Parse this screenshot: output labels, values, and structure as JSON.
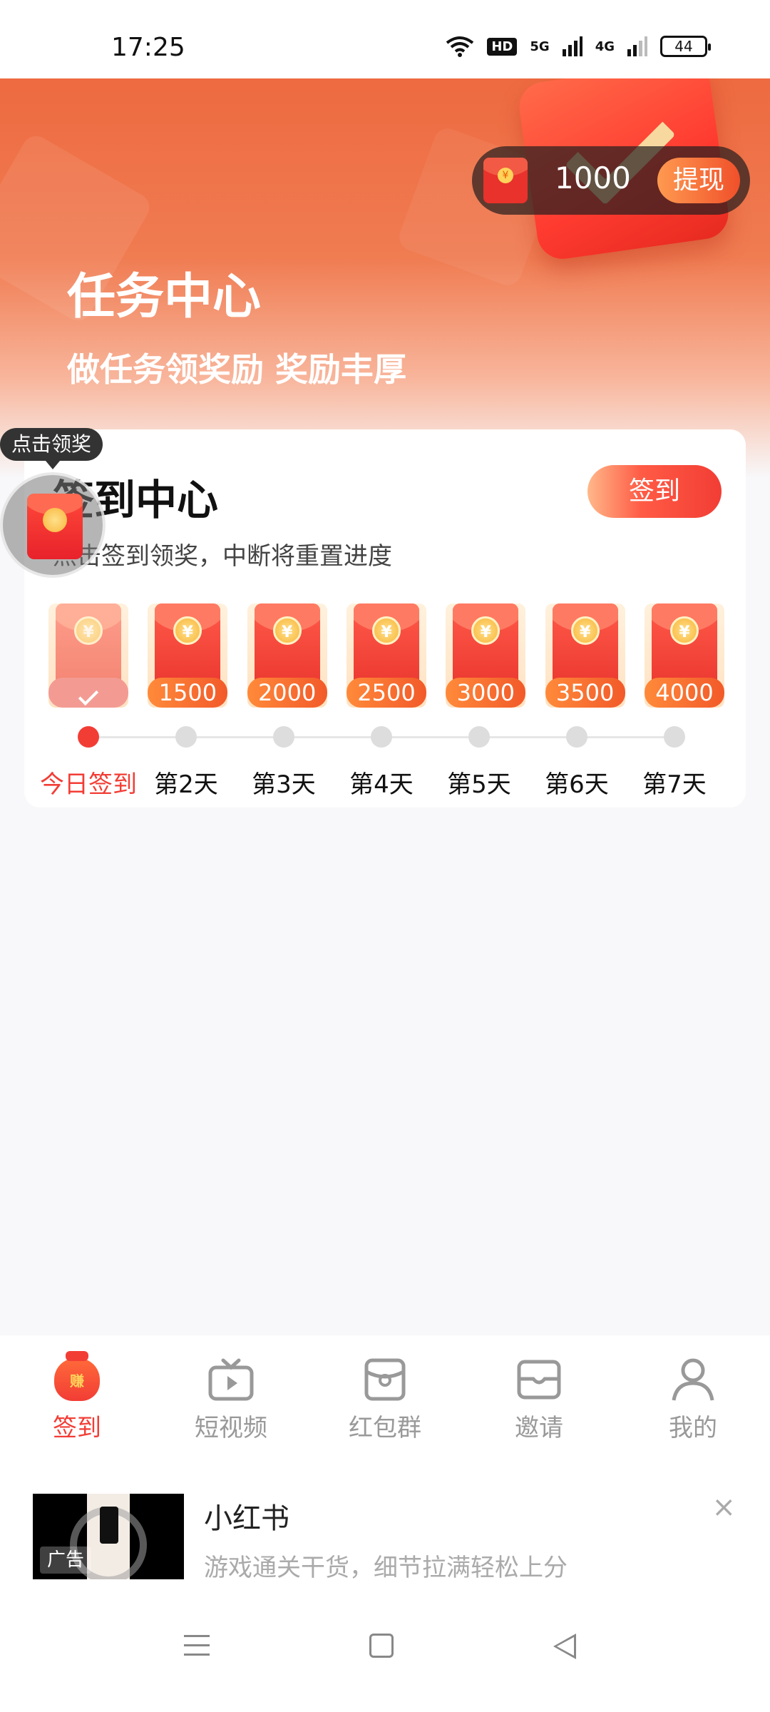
{
  "status_bar": {
    "time": "17:25",
    "hd_label": "HD",
    "network_1": "5G",
    "network_2": "4G",
    "battery": "44"
  },
  "banner": {
    "title": "任务中心",
    "subtitle": "做任务领奖励 奖励丰厚",
    "balance": "1000",
    "withdraw_label": "提现"
  },
  "checkin": {
    "title": "签到中心",
    "button_label": "签到",
    "subtitle": "点击签到领奖，中断将重置进度",
    "days": [
      {
        "label": "今日签到",
        "amount": "",
        "done": true
      },
      {
        "label": "第2天",
        "amount": "1500",
        "done": false
      },
      {
        "label": "第3天",
        "amount": "2000",
        "done": false
      },
      {
        "label": "第4天",
        "amount": "2500",
        "done": false
      },
      {
        "label": "第5天",
        "amount": "3000",
        "done": false
      },
      {
        "label": "第6天",
        "amount": "3500",
        "done": false
      },
      {
        "label": "第7天",
        "amount": "4000",
        "done": false
      }
    ]
  },
  "floating": {
    "tip": "点击领奖"
  },
  "bottom_nav": {
    "items": [
      {
        "label": "签到",
        "icon": "money-bag-icon",
        "active": true,
        "badge": "赚"
      },
      {
        "label": "短视频",
        "icon": "tv-play-icon",
        "active": false
      },
      {
        "label": "红包群",
        "icon": "red-envelope-group-icon",
        "active": false
      },
      {
        "label": "邀请",
        "icon": "mail-icon",
        "active": false
      },
      {
        "label": "我的",
        "icon": "user-icon",
        "active": false
      }
    ]
  },
  "ad": {
    "title": "小红书",
    "description": "游戏通关干货，细节拉满轻松上分",
    "tag": "广告",
    "close": "×"
  },
  "colors": {
    "accent": "#f23d35",
    "banner": "#ee6a40"
  }
}
